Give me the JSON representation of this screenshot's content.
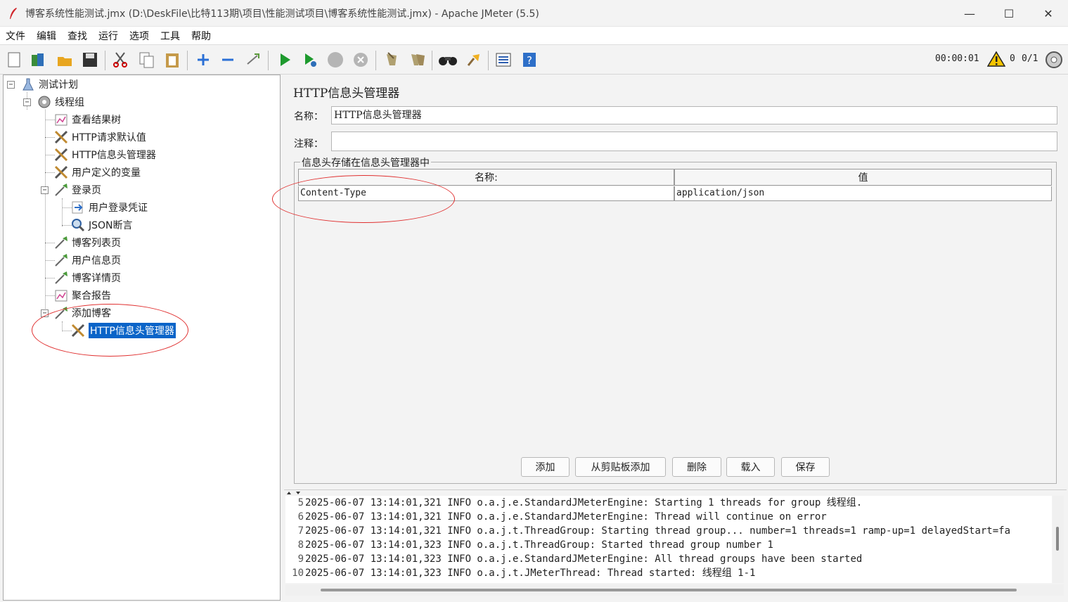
{
  "window": {
    "title": "博客系统性能测试.jmx (D:\\DeskFile\\比特113期\\项目\\性能测试项目\\博客系统性能测试.jmx) - Apache JMeter (5.5)",
    "minimize": "—",
    "maximize": "☐",
    "close": "✕"
  },
  "menu": [
    "文件",
    "编辑",
    "查找",
    "运行",
    "选项",
    "工具",
    "帮助"
  ],
  "toolbar": {
    "icons": [
      "new-icon",
      "templates-icon",
      "open-icon",
      "save-icon",
      "cut-icon",
      "copy-icon",
      "paste-icon",
      "expand-icon",
      "collapse-icon",
      "toggle-icon",
      "start-icon",
      "start-no-pause-icon",
      "stop-icon",
      "shutdown-icon",
      "clear-icon",
      "clear-all-icon",
      "search-icon",
      "reset-search-icon",
      "function-helper-icon",
      "help-icon"
    ],
    "timer": "00:00:01",
    "warning_count": "0",
    "threads": "0/1"
  },
  "tree": [
    {
      "label": "测试计划",
      "icon": "test-plan-icon",
      "level": 0
    },
    {
      "label": "线程组",
      "icon": "thread-group-icon",
      "level": 1
    },
    {
      "label": "查看结果树",
      "icon": "listener-icon",
      "level": 2
    },
    {
      "label": "HTTP请求默认值",
      "icon": "config-tools-icon",
      "level": 2
    },
    {
      "label": "HTTP信息头管理器",
      "icon": "config-tools-icon",
      "level": 2
    },
    {
      "label": "用户定义的变量",
      "icon": "config-tools-icon",
      "level": 2
    },
    {
      "label": "登录页",
      "icon": "sampler-pipette-icon",
      "level": 2
    },
    {
      "label": "用户登录凭证",
      "icon": "extractor-arrow-icon",
      "level": 3
    },
    {
      "label": "JSON断言",
      "icon": "assertion-magnifier-icon",
      "level": 3
    },
    {
      "label": "博客列表页",
      "icon": "sampler-pipette-icon",
      "level": 2
    },
    {
      "label": "用户信息页",
      "icon": "sampler-pipette-icon",
      "level": 2
    },
    {
      "label": "博客详情页",
      "icon": "sampler-pipette-icon",
      "level": 2
    },
    {
      "label": "聚合报告",
      "icon": "listener-icon",
      "level": 2
    },
    {
      "label": "添加博客",
      "icon": "sampler-pipette-icon",
      "level": 2
    },
    {
      "label": "HTTP信息头管理器",
      "icon": "config-tools-icon",
      "level": 3,
      "selected": true
    }
  ],
  "panel": {
    "title": "HTTP信息头管理器",
    "name_label": "名称：",
    "name_value": "HTTP信息头管理器",
    "comment_label": "注释：",
    "comment_value": "",
    "group_title": "信息头存储在信息头管理器中",
    "columns": [
      "名称:",
      "值"
    ],
    "rows": [
      [
        "Content-Type",
        "application/json"
      ]
    ],
    "buttons": [
      "添加",
      "从剪贴板添加",
      "删除",
      "载入",
      "保存"
    ]
  },
  "log": {
    "lines": [
      {
        "n": "5",
        "text": "2025-06-07 13:14:01,321 INFO o.a.j.e.StandardJMeterEngine: Starting 1 threads for group 线程组."
      },
      {
        "n": "6",
        "text": "2025-06-07 13:14:01,321 INFO o.a.j.e.StandardJMeterEngine: Thread will continue on error"
      },
      {
        "n": "7",
        "text": "2025-06-07 13:14:01,321 INFO o.a.j.t.ThreadGroup: Starting thread group... number=1 threads=1 ramp-up=1 delayedStart=fa"
      },
      {
        "n": "8",
        "text": "2025-06-07 13:14:01,323 INFO o.a.j.t.ThreadGroup: Started thread group number 1"
      },
      {
        "n": "9",
        "text": "2025-06-07 13:14:01,323 INFO o.a.j.e.StandardJMeterEngine: All thread groups have been started"
      },
      {
        "n": "10",
        "text": "2025-06-07 13:14:01,323 INFO o.a.j.t.JMeterThread: Thread started: 线程组 1-1"
      }
    ]
  },
  "colors": {
    "selection": "#0a64c8",
    "annotation": "#e03030"
  }
}
